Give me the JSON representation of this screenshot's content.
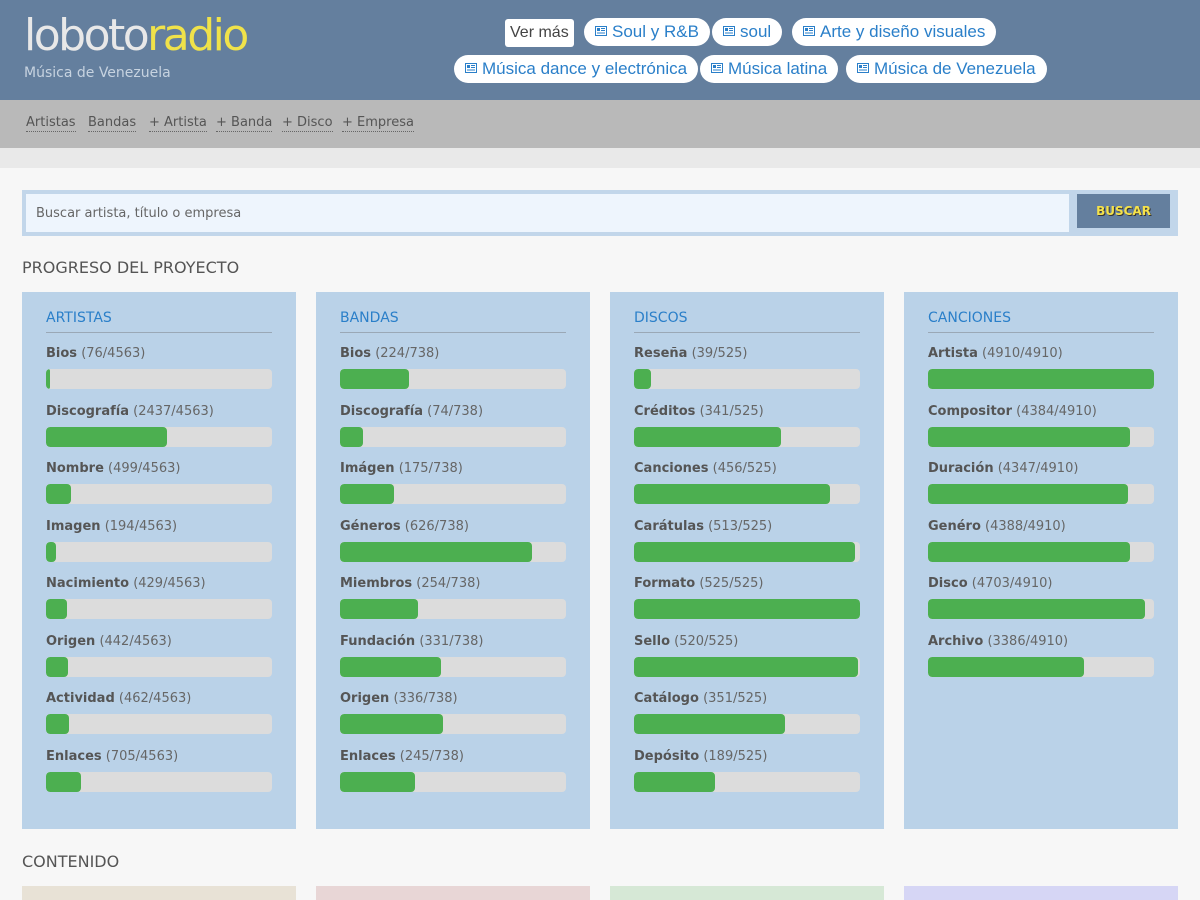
{
  "header": {
    "logo_part1": "loboto",
    "logo_part2": "radio",
    "tagline": "Música de Venezuela",
    "ver_mas": "Ver más",
    "tags": [
      "Soul y R&B",
      "soul",
      "Arte y diseño visuales",
      "Música dance y electrónica",
      "Música latina",
      "Música de Venezuela"
    ],
    "tag_icon": "newspaper-icon",
    "colors": {
      "bar": "#647f9e",
      "logo_accent": "#f0e24a",
      "link": "#2a7fc9"
    }
  },
  "nav": {
    "items": [
      "Artistas",
      "Bandas",
      "+ Artista",
      "+ Banda",
      "+ Disco",
      "+ Empresa"
    ]
  },
  "search": {
    "placeholder": "Buscar artista, título o empresa",
    "button": "BUSCAR"
  },
  "progress": {
    "title": "PROGRESO DEL PROYECTO",
    "fill_color": "#4caf50",
    "cards": [
      {
        "title": "ARTISTAS",
        "rows": [
          {
            "label": "Bios",
            "count": "(76/4563)",
            "pct": 0.017
          },
          {
            "label": "Discografía",
            "count": "(2437/4563)",
            "pct": 0.534
          },
          {
            "label": "Nombre",
            "count": "(499/4563)",
            "pct": 0.109
          },
          {
            "label": "Imagen",
            "count": "(194/4563)",
            "pct": 0.043
          },
          {
            "label": "Nacimiento",
            "count": "(429/4563)",
            "pct": 0.094
          },
          {
            "label": "Origen",
            "count": "(442/4563)",
            "pct": 0.097
          },
          {
            "label": "Actividad",
            "count": "(462/4563)",
            "pct": 0.101
          },
          {
            "label": "Enlaces",
            "count": "(705/4563)",
            "pct": 0.155
          }
        ]
      },
      {
        "title": "BANDAS",
        "rows": [
          {
            "label": "Bios",
            "count": "(224/738)",
            "pct": 0.304
          },
          {
            "label": "Discografía",
            "count": "(74/738)",
            "pct": 0.1
          },
          {
            "label": "Imágen",
            "count": "(175/738)",
            "pct": 0.237
          },
          {
            "label": "Géneros",
            "count": "(626/738)",
            "pct": 0.848
          },
          {
            "label": "Miembros",
            "count": "(254/738)",
            "pct": 0.344
          },
          {
            "label": "Fundación",
            "count": "(331/738)",
            "pct": 0.449
          },
          {
            "label": "Origen",
            "count": "(336/738)",
            "pct": 0.455
          },
          {
            "label": "Enlaces",
            "count": "(245/738)",
            "pct": 0.332
          }
        ]
      },
      {
        "title": "DISCOS",
        "rows": [
          {
            "label": "Reseña",
            "count": "(39/525)",
            "pct": 0.074
          },
          {
            "label": "Créditos",
            "count": "(341/525)",
            "pct": 0.65
          },
          {
            "label": "Canciones",
            "count": "(456/525)",
            "pct": 0.869
          },
          {
            "label": "Carátulas",
            "count": "(513/525)",
            "pct": 0.977
          },
          {
            "label": "Formato",
            "count": "(525/525)",
            "pct": 1.0
          },
          {
            "label": "Sello",
            "count": "(520/525)",
            "pct": 0.99
          },
          {
            "label": "Catálogo",
            "count": "(351/525)",
            "pct": 0.669
          },
          {
            "label": "Depósito",
            "count": "(189/525)",
            "pct": 0.36
          }
        ]
      },
      {
        "title": "CANCIONES",
        "rows": [
          {
            "label": "Artista",
            "count": "(4910/4910)",
            "pct": 1.0
          },
          {
            "label": "Compositor",
            "count": "(4384/4910)",
            "pct": 0.893
          },
          {
            "label": "Duración",
            "count": "(4347/4910)",
            "pct": 0.885
          },
          {
            "label": "Genéro",
            "count": "(4388/4910)",
            "pct": 0.894
          },
          {
            "label": "Disco",
            "count": "(4703/4910)",
            "pct": 0.958
          },
          {
            "label": "Archivo",
            "count": "(3386/4910)",
            "pct": 0.69
          }
        ]
      }
    ]
  },
  "content": {
    "title": "CONTENIDO",
    "box_colors": [
      "#e8e2d6",
      "#e8d6d6",
      "#d6e8d6",
      "#d6d6f5"
    ]
  }
}
